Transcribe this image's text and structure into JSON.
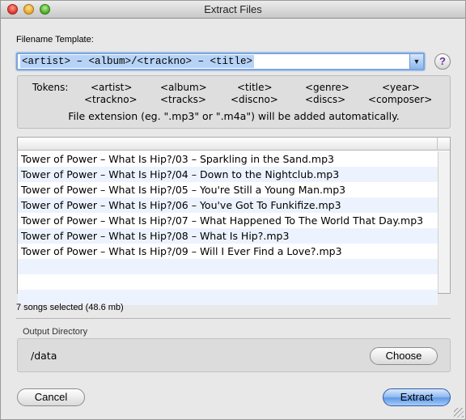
{
  "window": {
    "title": "Extract Files"
  },
  "template": {
    "label": "Filename Template:",
    "value": "<artist> – <album>/<trackno> – <title>",
    "help_label": "?"
  },
  "tokens": {
    "label": "Tokens:",
    "items": [
      "<artist>",
      "<album>",
      "<title>",
      "<genre>",
      "<year>",
      "<trackno>",
      "<tracks>",
      "<discno>",
      "<discs>",
      "<composer>"
    ],
    "note": "File extension (eg. \".mp3\" or \".m4a\") will be added automatically."
  },
  "files": [
    "Tower of Power – What Is Hip?/03 – Sparkling in the Sand.mp3",
    "Tower of Power – What Is Hip?/04 – Down to the Nightclub.mp3",
    "Tower of Power – What Is Hip?/05 – You're Still a Young Man.mp3",
    "Tower of Power – What Is Hip?/06 – You've Got To Funkifize.mp3",
    "Tower of Power – What Is Hip?/07 – What Happened To The World That Day.mp3",
    "Tower of Power – What Is Hip?/08 – What Is Hip?.mp3",
    "Tower of Power – What Is Hip?/09 – Will I Ever Find a Love?.mp3"
  ],
  "selection_summary": "7 songs selected (48.6 mb)",
  "output": {
    "label": "Output Directory",
    "path": "/data",
    "choose_label": "Choose"
  },
  "buttons": {
    "cancel": "Cancel",
    "extract": "Extract"
  }
}
